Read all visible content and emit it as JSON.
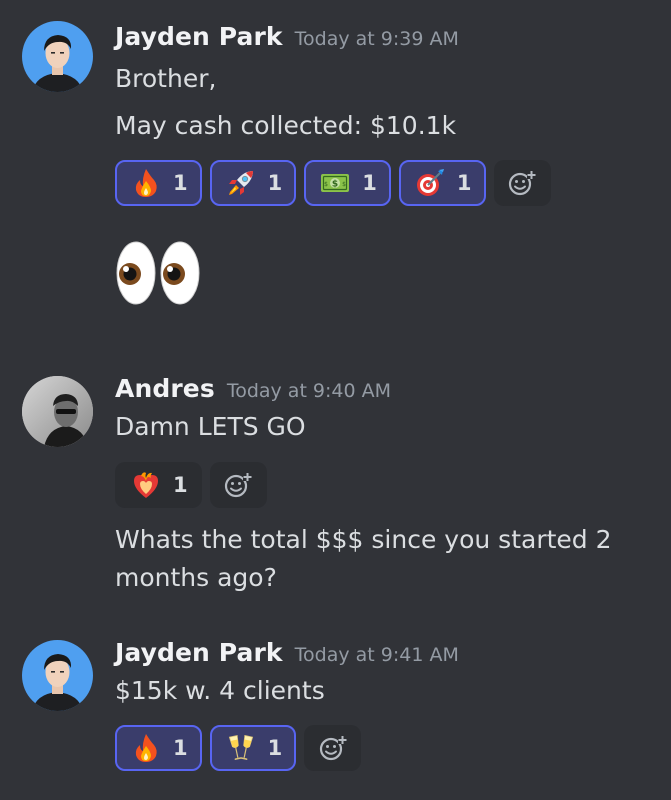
{
  "messages": [
    {
      "username": "Jayden Park",
      "timestamp": "Today at 9:39 AM",
      "lines": [
        "Brother,",
        "May cash collected: $10.1k"
      ],
      "reactions": [
        {
          "emoji": "fire-icon",
          "count": "1",
          "selected": true
        },
        {
          "emoji": "rocket-icon",
          "count": "1",
          "selected": true
        },
        {
          "emoji": "dollar-bill-icon",
          "count": "1",
          "selected": true
        },
        {
          "emoji": "target-icon",
          "count": "1",
          "selected": true
        }
      ],
      "followup_emoji": "eyes-icon"
    },
    {
      "username": "Andres",
      "timestamp": "Today at 9:40 AM",
      "lines": [
        "Damn LETS GO"
      ],
      "reactions": [
        {
          "emoji": "heart-on-fire-icon",
          "count": "1",
          "selected": false
        }
      ],
      "followup_lines": [
        "Whats the total $$$ since you started 2",
        "months ago?"
      ]
    },
    {
      "username": "Jayden Park",
      "timestamp": "Today at 9:41 AM",
      "lines": [
        "$15k w. 4 clients"
      ],
      "reactions": [
        {
          "emoji": "fire-icon",
          "count": "1",
          "selected": true
        },
        {
          "emoji": "champagne-icon",
          "count": "1",
          "selected": true
        }
      ]
    }
  ],
  "colors": {
    "background": "#313338",
    "reaction_selected_bg": "#3a3d6b",
    "reaction_selected_border": "#5865f2",
    "username": "#f2f3f5",
    "timestamp": "#949ba4"
  }
}
